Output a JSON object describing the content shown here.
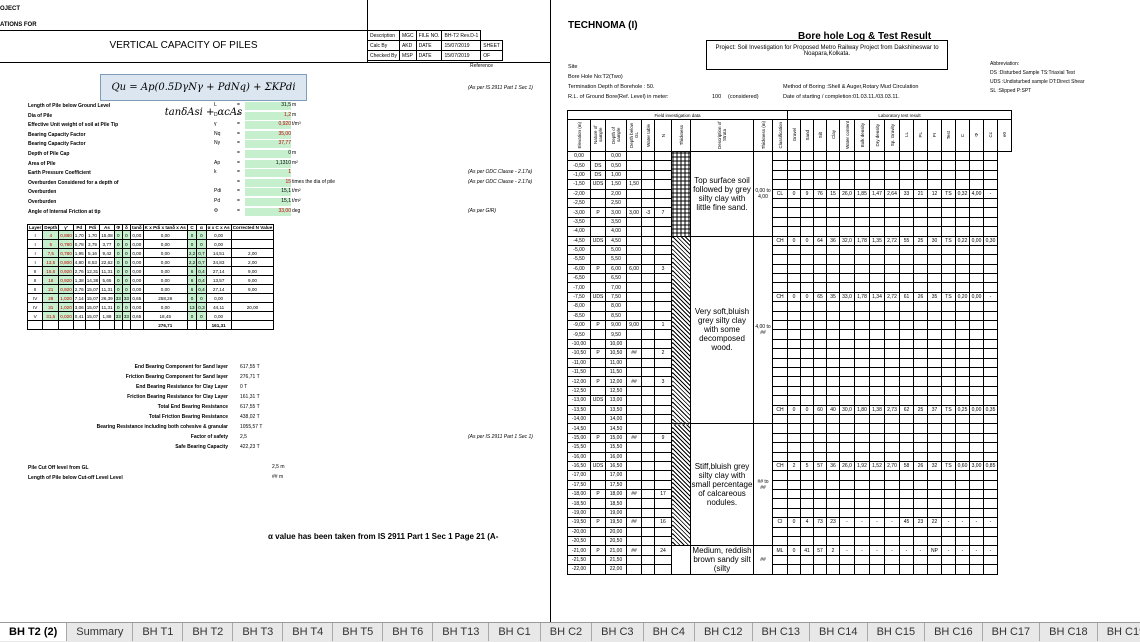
{
  "left": {
    "header_lines": [
      "OJECT",
      "ATIONS FOR"
    ],
    "title": "VERTICAL CAPACITY OF PILES",
    "meta": [
      [
        "Description",
        "MGC",
        "FILE NO.",
        "BH-T2 Rev.D-1"
      ],
      [
        "Calc By",
        "AKD",
        "DATE",
        "15/07/2019",
        "SHEET"
      ],
      [
        "Checked By",
        "MSP",
        "DATE",
        "15/07/2019",
        "OF"
      ]
    ],
    "reference": "Reference",
    "formula": "Qu = Ap(0.5DγNγ + PdNq) + ΣKPdi tanδAsi + αcAs",
    "formula_ref": "(As per IS 2911 Part 1 Sec 1)",
    "params": [
      {
        "label": "Length of Pile below Ground Level",
        "sym": "L",
        "val": "31,5",
        "unit": "m",
        "note": ""
      },
      {
        "label": "Dia of Pile",
        "sym": "D",
        "val": "1,2",
        "unit": "m",
        "note": "",
        "red": true
      },
      {
        "label": "Effective Unit weight of soil at Pile Tip",
        "sym": "γ",
        "val": "0,920",
        "unit": "t/m³",
        "note": "",
        "red": true
      },
      {
        "label": "Bearing Capacity Factor",
        "sym": "Nq",
        "val": "35,00",
        "unit": "",
        "note": "",
        "red": true
      },
      {
        "label": "Bearing Capacity Factor",
        "sym": "Nγ",
        "val": "37,77",
        "unit": "",
        "note": "",
        "red": true
      },
      {
        "label": "Depth of Pile Cap",
        "sym": "",
        "val": "0",
        "unit": "m",
        "note": ""
      },
      {
        "label": "Area of Pile",
        "sym": "Ap",
        "val": "1,1310",
        "unit": "m²",
        "note": ""
      },
      {
        "label": "Earth Pressure Coefficient",
        "sym": "k",
        "val": "1",
        "unit": "",
        "note": "(As per ODC Clause - 2.17a)",
        "red": true
      },
      {
        "label": "Overburden Considered for a depth of",
        "sym": "",
        "val": "15",
        "unit": "times the dia of pile",
        "note": "(As per ODC Clause - 2.17a)",
        "red": true
      },
      {
        "label": "Overburden",
        "sym": "Pdi",
        "val": "15,1",
        "unit": "t/m²",
        "note": ""
      },
      {
        "label": "Overburden",
        "sym": "Pd",
        "val": "15,1",
        "unit": "t/m²",
        "note": ""
      },
      {
        "label": "Angle of Internal Friction at tip",
        "sym": "Φ",
        "val": "33,00",
        "unit": "deg",
        "note": "(As per GIR)",
        "red": true
      }
    ],
    "table_headers": [
      "Layer",
      "Depth",
      "γ'",
      "Pd",
      "Pdi",
      "As",
      "Φ",
      "δ",
      "tanδ",
      "K x Pdi x tanδ x As",
      "C",
      "α",
      "α x C x As",
      "Corrected N Value"
    ],
    "table_rows": [
      [
        "I",
        "4",
        "0,880",
        "1,70",
        "1,70",
        "15,08",
        "0",
        "0",
        "0,00",
        "0,00",
        "0",
        "0",
        "0,00",
        ""
      ],
      [
        "I",
        "5",
        "0,780",
        "0,78",
        "3,79",
        "3,77",
        "0",
        "0",
        "0,00",
        "0,00",
        "0",
        "0",
        "0,00",
        ""
      ],
      [
        "I",
        "7,5",
        "0,780",
        "1,95",
        "5,16",
        "9,42",
        "0",
        "0",
        "0,00",
        "0,00",
        "2,2",
        "0,7",
        "14,51",
        "2,00"
      ],
      [
        "I",
        "13,5",
        "0,800",
        "4,80",
        "8,53",
        "22,62",
        "0",
        "0",
        "0,00",
        "0,00",
        "2,2",
        "0,7",
        "34,83",
        "2,00"
      ],
      [
        "II",
        "15,5",
        "0,920",
        "2,76",
        "12,31",
        "11,31",
        "0",
        "0",
        "0,00",
        "0,00",
        "6",
        "0,4",
        "27,14",
        "9,00"
      ],
      [
        "II",
        "18",
        "0,920",
        "1,38",
        "14,38",
        "5,65",
        "0",
        "0",
        "0,00",
        "0,00",
        "6",
        "0,4",
        "13,57",
        "9,00"
      ],
      [
        "II",
        "21",
        "0,920",
        "2,76",
        "15,07",
        "11,31",
        "0",
        "0",
        "0,00",
        "0,00",
        "6",
        "0,4",
        "27,14",
        "9,00"
      ],
      [
        "IV",
        "28",
        "1,020",
        "7,14",
        "15,07",
        "26,39",
        "33",
        "33",
        "0,65",
        "258,26",
        "0",
        "0",
        "0,00",
        ""
      ],
      [
        "IV",
        "31",
        "1,020",
        "3,06",
        "15,07",
        "11,31",
        "0",
        "0",
        "0,00",
        "0,00",
        "13",
        "0,3",
        "44,11",
        "20,00"
      ],
      [
        "V",
        "31,5",
        "0,020",
        "0,41",
        "15,07",
        "1,88",
        "33",
        "33",
        "0,65",
        "18,45",
        "0",
        "0",
        "0,00",
        ""
      ]
    ],
    "totals": [
      "276,71",
      "161,31"
    ],
    "summary": [
      {
        "label": "End Bearing Component for Sand layer",
        "val": "617,55",
        "unit": "T"
      },
      {
        "label": "Friction Bearing Component for Sand layer",
        "val": "276,71",
        "unit": "T"
      },
      {
        "label": "End Bearing Resistance for Clay Layer",
        "val": "0",
        "unit": "T"
      },
      {
        "label": "Friction Bearing Resistance for Clay Layer",
        "val": "161,31",
        "unit": "T"
      },
      {
        "label": "Total End Bearing Resistance",
        "val": "617,55",
        "unit": "T"
      },
      {
        "label": "Total Friction Bearing Resistance",
        "val": "438,02",
        "unit": "T"
      },
      {
        "label": "Bearing Resistance including both cohesive & granular",
        "val": "1055,57",
        "unit": "T"
      },
      {
        "label": "Factor of safety",
        "val": "2,5",
        "unit": ""
      },
      {
        "label": "Safe Bearing Capacity",
        "val": "422,23",
        "unit": "T"
      }
    ],
    "summary_ref": "(As per IS 2911 Part 1 Sec 1)",
    "cutoff": [
      {
        "label": "Pile Cut Off level from GL",
        "val": "2,5",
        "unit": "m"
      },
      {
        "label": "Length of Pile below Cut-off Level Level",
        "val": "##",
        "unit": "m"
      }
    ],
    "note": "α value has been taken from IS 2911 Part 1 Sec 1 Page 21 (A-"
  },
  "right": {
    "company": "TECHNOMA (I)",
    "title": "Bore hole Log & Test Result",
    "project": "Project: Soil Investigation for Proposed Metro Railway Project from Dakshineswar to Noapara,Kolkata.",
    "site": "Site",
    "borehole": "Bore Hole No:T2(Two)",
    "termination": "Termination Depth of Borehole : 50.",
    "rl": "R.L. of Ground Bore(Ref. Level) in meter:",
    "rl_val": "100",
    "rl_note": "(considered)",
    "method": "Method of Boring :Shell & Auger,Rotary Mud Circulation",
    "date": "Date of starting / completion:01.03.11./03.03.11.",
    "abbr_title": "Abbreviation:",
    "abbr": [
      [
        "DS",
        ":Disturbed Sample",
        "TS:Triaxial Test"
      ],
      [
        "UDS",
        ":Undisturbed sample",
        "DT:Direct Shear"
      ],
      [
        "SL",
        ":Slipped",
        "P:SPT"
      ]
    ],
    "field_header": "Field investigation data",
    "lab_header": "Laboratory test result",
    "col_headers": [
      "Elevation (m)",
      "Nature of sample",
      "Depth of sample",
      "Depth below GL",
      "Water table",
      "N",
      "Thickness",
      "Description of Strata",
      "Thickness (m)",
      "Classification",
      "Gravel",
      "Sand",
      "Silt",
      "Clay",
      "Water content",
      "Bulk density",
      "Dry density",
      "Sp. Gravity",
      "LL",
      "PL",
      "PI",
      "Test",
      "C",
      "Φ",
      "Cc",
      "e0"
    ],
    "rows": [
      [
        "0,00",
        "",
        "0,00",
        "",
        "",
        "",
        ""
      ],
      [
        "-0,50",
        "DS",
        "0,50",
        "",
        "",
        "",
        ""
      ],
      [
        "-1,00",
        "DS",
        "1,00",
        "",
        "",
        "",
        ""
      ],
      [
        "-1,50",
        "UDS",
        "1,50",
        "1,50",
        "",
        "",
        ""
      ],
      [
        "-2,00",
        "",
        "2,00",
        "",
        "",
        "",
        ""
      ],
      [
        "-2,50",
        "",
        "2,50",
        "",
        "",
        "",
        ""
      ],
      [
        "-3,00",
        "P",
        "3,00",
        "3,00",
        "",
        "7",
        ""
      ],
      [
        "-3,50",
        "",
        "3,50",
        "",
        "",
        "",
        ""
      ],
      [
        "-4,00",
        "",
        "4,00",
        "",
        "",
        "",
        ""
      ],
      [
        "-4,50",
        "UDS",
        "4,50",
        "",
        "",
        "",
        ""
      ],
      [
        "-5,00",
        "",
        "5,00",
        "",
        "",
        "",
        ""
      ],
      [
        "-5,50",
        "",
        "5,50",
        "",
        "",
        "",
        ""
      ],
      [
        "-6,00",
        "P",
        "6,00",
        "6,00",
        "",
        "3",
        ""
      ],
      [
        "-6,50",
        "",
        "6,50",
        "",
        "",
        "",
        ""
      ],
      [
        "-7,00",
        "",
        "7,00",
        "",
        "",
        "",
        ""
      ],
      [
        "-7,50",
        "UDS",
        "7,50",
        "",
        "",
        "",
        ""
      ],
      [
        "-8,00",
        "",
        "8,00",
        "",
        "",
        "",
        ""
      ],
      [
        "-8,50",
        "",
        "8,50",
        "",
        "",
        "",
        ""
      ],
      [
        "-9,00",
        "P",
        "9,00",
        "9,00",
        "",
        "1",
        ""
      ],
      [
        "-9,50",
        "",
        "9,50",
        "",
        "",
        "",
        ""
      ],
      [
        "-10,00",
        "",
        "10,00",
        "",
        "",
        "",
        ""
      ],
      [
        "-10,50",
        "P",
        "10,50",
        "##",
        "",
        "2",
        ""
      ],
      [
        "-11,00",
        "",
        "11,00",
        "",
        "",
        "",
        ""
      ],
      [
        "-11,50",
        "",
        "11,50",
        "",
        "",
        "",
        ""
      ],
      [
        "-12,00",
        "P",
        "12,00",
        "##",
        "",
        "3",
        ""
      ],
      [
        "-12,50",
        "",
        "12,50",
        "",
        "",
        "",
        ""
      ],
      [
        "-13,00",
        "UDS",
        "13,00",
        "",
        "",
        "",
        ""
      ],
      [
        "-13,50",
        "",
        "13,50",
        "",
        "",
        "",
        ""
      ],
      [
        "-14,00",
        "",
        "14,00",
        "",
        "",
        "",
        ""
      ],
      [
        "-14,50",
        "",
        "14,50",
        "",
        "",
        "",
        ""
      ],
      [
        "-15,00",
        "P",
        "15,00",
        "##",
        "",
        "9",
        ""
      ],
      [
        "-15,50",
        "",
        "15,50",
        "",
        "",
        "",
        ""
      ],
      [
        "-16,00",
        "",
        "16,00",
        "",
        "",
        "",
        ""
      ],
      [
        "-16,50",
        "UDS",
        "16,50",
        "",
        "",
        "",
        ""
      ],
      [
        "-17,00",
        "",
        "17,00",
        "",
        "",
        "",
        ""
      ],
      [
        "-17,50",
        "",
        "17,50",
        "",
        "",
        "",
        ""
      ],
      [
        "-18,00",
        "P",
        "18,00",
        "##",
        "",
        "17",
        ""
      ],
      [
        "-18,50",
        "",
        "18,50",
        "",
        "",
        "",
        ""
      ],
      [
        "-19,00",
        "",
        "19,00",
        "",
        "",
        "",
        ""
      ],
      [
        "-19,50",
        "P",
        "19,50",
        "##",
        "",
        "16",
        ""
      ],
      [
        "-20,00",
        "",
        "20,00",
        "",
        "",
        "",
        ""
      ],
      [
        "-20,50",
        "",
        "20,50",
        "",
        "",
        "",
        ""
      ],
      [
        "-21,00",
        "P",
        "21,00",
        "##",
        "",
        "24",
        ""
      ],
      [
        "-21,50",
        "",
        "21,50",
        "",
        "",
        "",
        ""
      ],
      [
        "-22,00",
        "",
        "22,00",
        "",
        "",
        "",
        ""
      ]
    ],
    "water_mark": "-3",
    "strata": [
      {
        "text": "Top surface soil followed by grey silty clay with little fine sand.",
        "to": "to",
        "thick_top": "0,00",
        "thick_bot": "4,00"
      },
      {
        "text": "Very soft,bluish grey silty clay with some decomposed wood.",
        "to": "to",
        "thick_top": "4,00",
        "thick_bot": "##"
      },
      {
        "text": "Stiff,bluish grey silty clay with small percentage of calcareous nodules.",
        "to": "to",
        "thick_top": "##",
        "thick_bot": "##"
      },
      {
        "text": "Medium, reddish brown sandy silt (silty",
        "to": "",
        "thick_top": "##",
        "thick_bot": ""
      }
    ],
    "lab_rows": [
      {
        "row": 4,
        "vals": [
          "CL",
          "0",
          "9",
          "76",
          "15",
          "26,0",
          "1,85",
          "1,47",
          "2,64",
          "33",
          "21",
          "12",
          "TS",
          "0,32",
          "4,00",
          "-"
        ]
      },
      {
        "row": 9,
        "vals": [
          "CH",
          "0",
          "0",
          "64",
          "36",
          "32,0",
          "1,78",
          "1,35",
          "2,72",
          "55",
          "25",
          "30",
          "TS",
          "0,22",
          "0,00",
          "0,30"
        ]
      },
      {
        "row": 15,
        "vals": [
          "CH",
          "0",
          "0",
          "65",
          "35",
          "33,0",
          "1,78",
          "1,34",
          "2,72",
          "61",
          "26",
          "35",
          "TS",
          "0,20",
          "0,00",
          "-"
        ]
      },
      {
        "row": 27,
        "vals": [
          "CH",
          "0",
          "0",
          "60",
          "40",
          "30,0",
          "1,80",
          "1,38",
          "2,73",
          "62",
          "25",
          "37",
          "TS",
          "0,25",
          "0,00",
          "0,35"
        ]
      },
      {
        "row": 33,
        "vals": [
          "CH",
          "2",
          "5",
          "57",
          "36",
          "26,0",
          "1,92",
          "1,52",
          "2,70",
          "58",
          "26",
          "32",
          "TS",
          "0,60",
          "3,00",
          "0,85"
        ]
      },
      {
        "row": 39,
        "vals": [
          "CI",
          "0",
          "4",
          "73",
          "23",
          "-",
          "-",
          "-",
          "-",
          "45",
          "23",
          "22",
          "-",
          "-",
          "-",
          "-"
        ]
      },
      {
        "row": 42,
        "vals": [
          "ML",
          "0",
          "41",
          "57",
          "2",
          "-",
          "-",
          "-",
          "-",
          "-",
          "-",
          "NP",
          "-",
          "-",
          "-",
          "-"
        ]
      }
    ]
  },
  "tabs": [
    "BH T2 (2)",
    "Summary",
    "BH T1",
    "BH T2",
    "BH T3",
    "BH T4",
    "BH T5",
    "BH T6",
    "BH T13",
    "BH C1",
    "BH C2",
    "BH C3",
    "BH C4",
    "BH C12",
    "BH C13",
    "BH C14",
    "BH C15",
    "BH C16",
    "BH C17",
    "BH C18",
    "BH C19"
  ],
  "active_tab": 0
}
